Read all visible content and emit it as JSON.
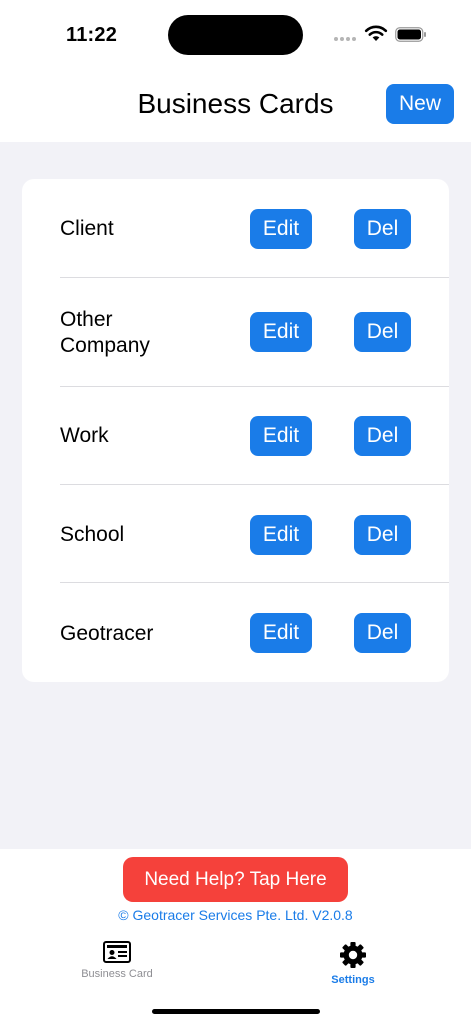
{
  "status_bar": {
    "time": "11:22"
  },
  "nav": {
    "title": "Business Cards",
    "new_label": "New"
  },
  "cards": [
    {
      "name": "Client",
      "edit_label": "Edit",
      "delete_label": "Del"
    },
    {
      "name": "Other Company",
      "edit_label": "Edit",
      "delete_label": "Del"
    },
    {
      "name": "Work",
      "edit_label": "Edit",
      "delete_label": "Del"
    },
    {
      "name": "School",
      "edit_label": "Edit",
      "delete_label": "Del"
    },
    {
      "name": "Geotracer",
      "edit_label": "Edit",
      "delete_label": "Del"
    }
  ],
  "footer": {
    "help_label": "Need Help? Tap Here",
    "copyright": "© Geotracer Services Pte. Ltd. V2.0.8"
  },
  "tab_bar": [
    {
      "label": "Business Card",
      "icon": "id-card-icon",
      "active": false
    },
    {
      "label": "Settings",
      "icon": "gear-icon",
      "active": true
    }
  ],
  "colors": {
    "accent": "#1a7ce8",
    "help": "#f5413b",
    "background": "#f2f2f7"
  }
}
